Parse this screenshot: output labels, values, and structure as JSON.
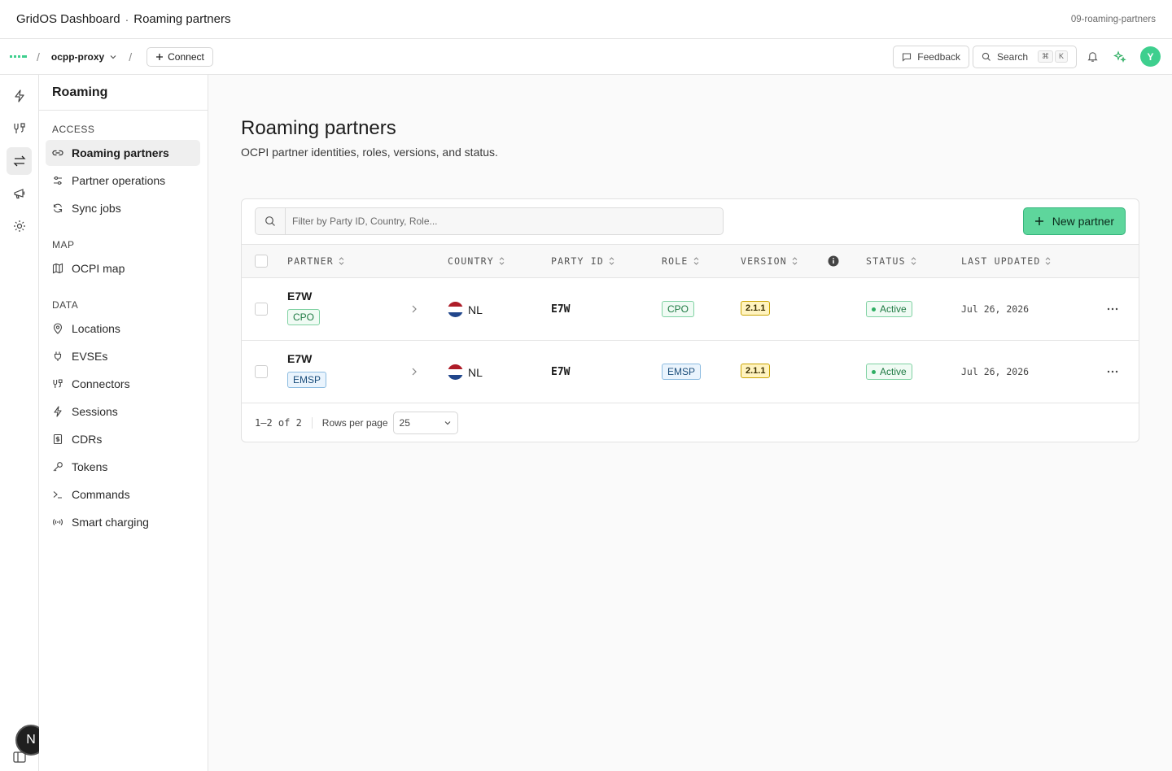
{
  "titlebar": {
    "app": "GridOS Dashboard",
    "separator": "·",
    "page": "Roaming partners",
    "route": "09-roaming-partners"
  },
  "topnav": {
    "project": "ocpp-proxy",
    "connect_label": "Connect",
    "feedback_label": "Feedback",
    "search_label": "Search",
    "search_kbd": [
      "⌘",
      "K"
    ],
    "avatar_initial": "Y"
  },
  "sidebar": {
    "title": "Roaming",
    "sections": [
      {
        "label": "ACCESS",
        "items": [
          {
            "label": "Roaming partners",
            "icon": "link-icon",
            "active": true
          },
          {
            "label": "Partner operations",
            "icon": "sliders-icon"
          },
          {
            "label": "Sync jobs",
            "icon": "refresh-icon"
          }
        ]
      },
      {
        "label": "MAP",
        "items": [
          {
            "label": "OCPI map",
            "icon": "map-icon"
          }
        ]
      },
      {
        "label": "DATA",
        "items": [
          {
            "label": "Locations",
            "icon": "pin-icon"
          },
          {
            "label": "EVSEs",
            "icon": "plug-icon"
          },
          {
            "label": "Connectors",
            "icon": "connector-icon"
          },
          {
            "label": "Sessions",
            "icon": "bolt-icon"
          },
          {
            "label": "CDRs",
            "icon": "receipt-icon"
          },
          {
            "label": "Tokens",
            "icon": "key-icon"
          },
          {
            "label": "Commands",
            "icon": "terminal-icon"
          },
          {
            "label": "Smart charging",
            "icon": "radio-icon"
          }
        ]
      }
    ]
  },
  "rail": {
    "user_initial": "N"
  },
  "main": {
    "title": "Roaming partners",
    "subtitle": "OCPI partner identities, roles, versions, and status.",
    "filter_placeholder": "Filter by Party ID, Country, Role...",
    "new_button": "New partner",
    "columns": [
      "PARTNER",
      "COUNTRY",
      "PARTY ID",
      "ROLE",
      "VERSION",
      "STATUS",
      "LAST UPDATED"
    ],
    "rows": [
      {
        "partner": "E7W",
        "partner_role": "CPO",
        "country": "NL",
        "party_id": "E7W",
        "role": "CPO",
        "version": "2.1.1",
        "status": "Active",
        "updated": "Jul 26, 2026"
      },
      {
        "partner": "E7W",
        "partner_role": "EMSP",
        "country": "NL",
        "party_id": "E7W",
        "role": "EMSP",
        "version": "2.1.1",
        "status": "Active",
        "updated": "Jul 26, 2026"
      }
    ],
    "footer": {
      "count": "1–2 of 2",
      "rows_per_page_label": "Rows per page",
      "rows_per_page": "25"
    }
  },
  "colors": {
    "accent": "#3ecf8e",
    "button": "#5ed69c",
    "version_badge": "#fff3bf"
  }
}
